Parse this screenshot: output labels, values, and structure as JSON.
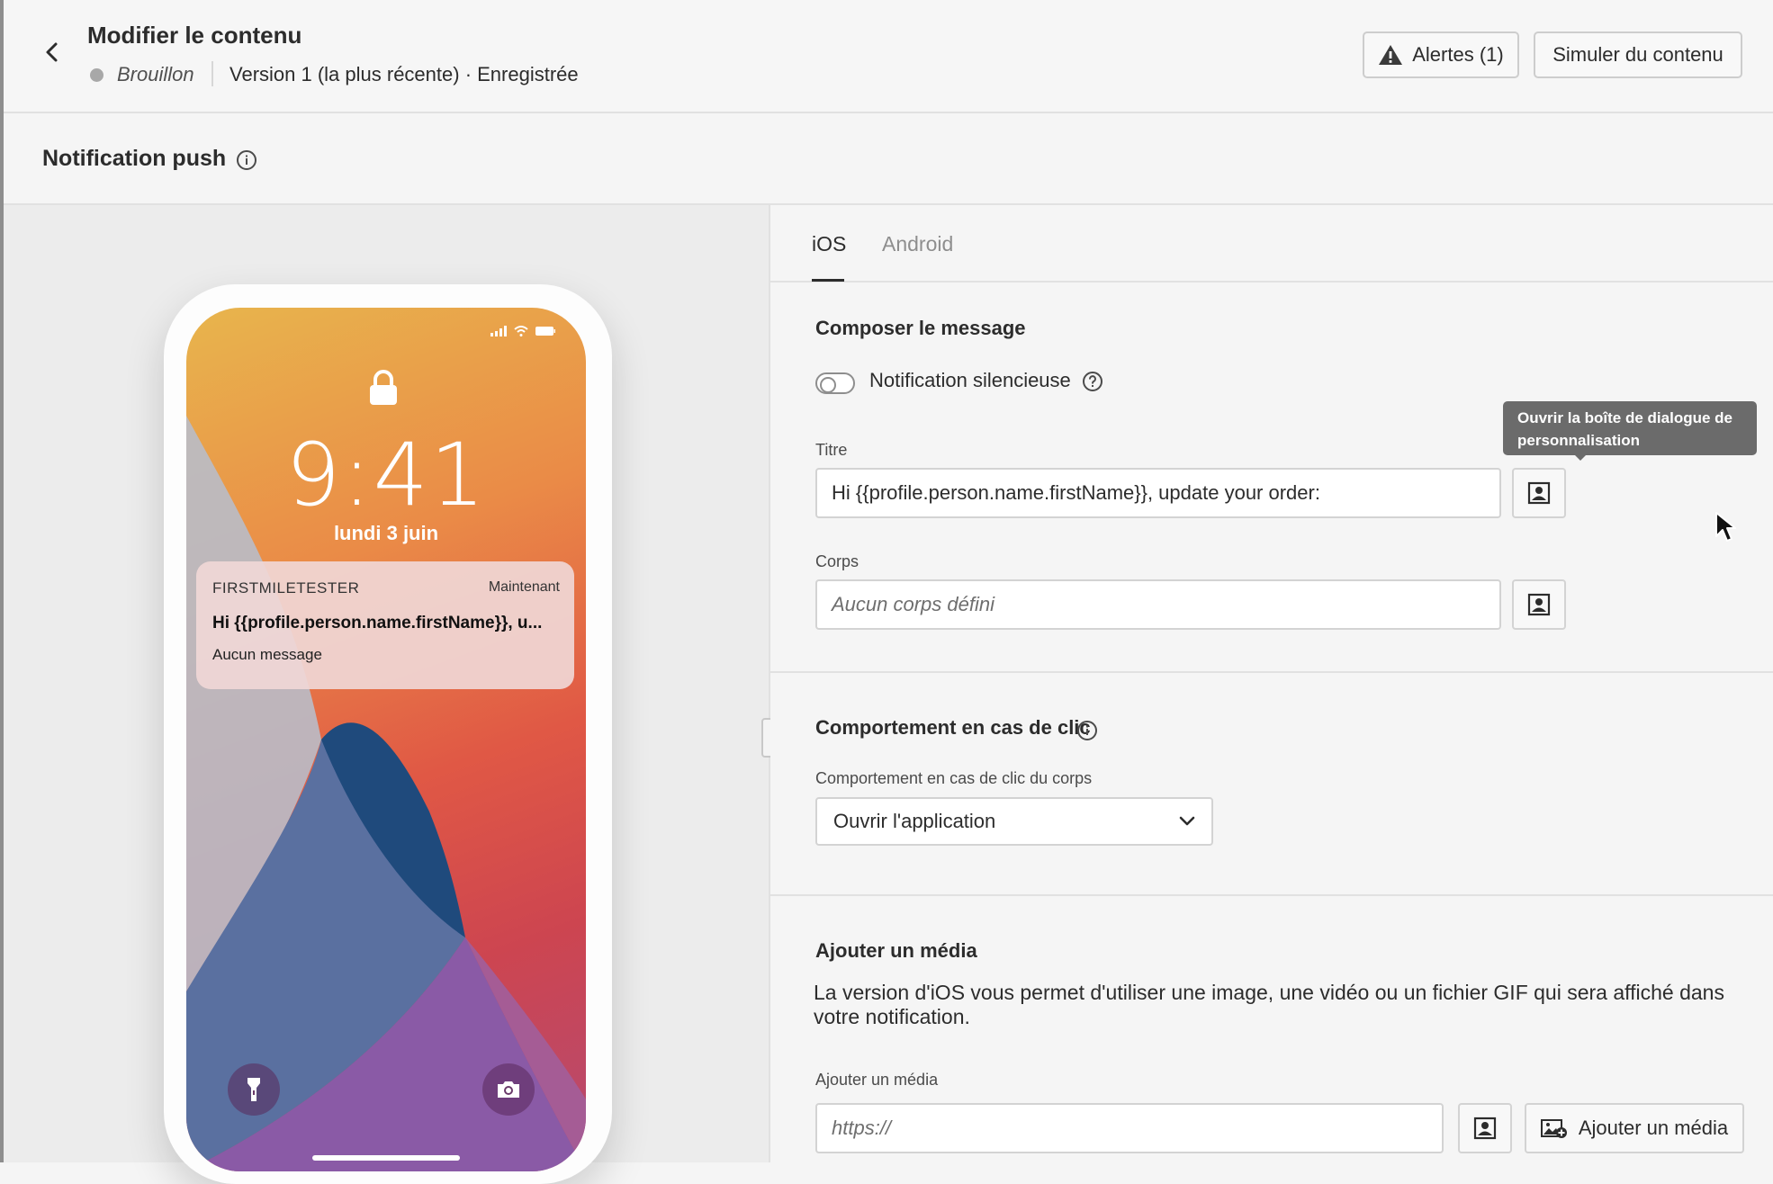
{
  "header": {
    "title": "Modifier le contenu",
    "status": "Brouillon",
    "version": "Version 1 (la plus récente) · Enregistrée",
    "alerts_label": "Alertes (1)",
    "simulate_label": "Simuler du contenu"
  },
  "section": {
    "title": "Notification push"
  },
  "preview": {
    "time": "9:41",
    "date": "lundi 3 juin",
    "notification": {
      "app": "FIRSTMILETESTER",
      "timestamp": "Maintenant",
      "title": "Hi {{profile.person.name.firstName}}, u...",
      "body": "Aucun message"
    }
  },
  "tabs": [
    {
      "label": "iOS",
      "active": true
    },
    {
      "label": "Android",
      "active": false
    }
  ],
  "compose": {
    "heading": "Composer le message",
    "silent_label": "Notification silencieuse",
    "silent_on": false,
    "title_label": "Titre",
    "title_value": "Hi {{profile.person.name.firstName}}, update your order:",
    "tooltip": "Ouvrir la boîte de dialogue de personnalisation",
    "body_label": "Corps",
    "body_placeholder": "Aucun corps défini"
  },
  "click": {
    "heading": "Comportement en cas de clic",
    "field_label": "Comportement en cas de clic du corps",
    "selected": "Ouvrir l'application"
  },
  "media": {
    "heading": "Ajouter un média",
    "description": "La version d'iOS vous permet d'utiliser une image, une vidéo ou un fichier GIF qui sera affiché dans votre notification.",
    "field_label": "Ajouter un média",
    "placeholder": "https://",
    "button_label": "Ajouter un média"
  },
  "colors": {
    "accent_text": "#2c2c2c",
    "muted_tab": "#8e8e8e",
    "tooltip_bg": "#6b6b6b",
    "status_dot": "#a8a8a8"
  },
  "icons": [
    "chevron-left-icon",
    "alert-triangle-icon",
    "info-icon",
    "help-icon",
    "personalization-icon",
    "chevron-down-icon",
    "add-image-icon",
    "lock-icon",
    "flashlight-icon",
    "camera-icon",
    "signal-icon",
    "wifi-icon",
    "battery-icon",
    "mouse-cursor-icon"
  ]
}
